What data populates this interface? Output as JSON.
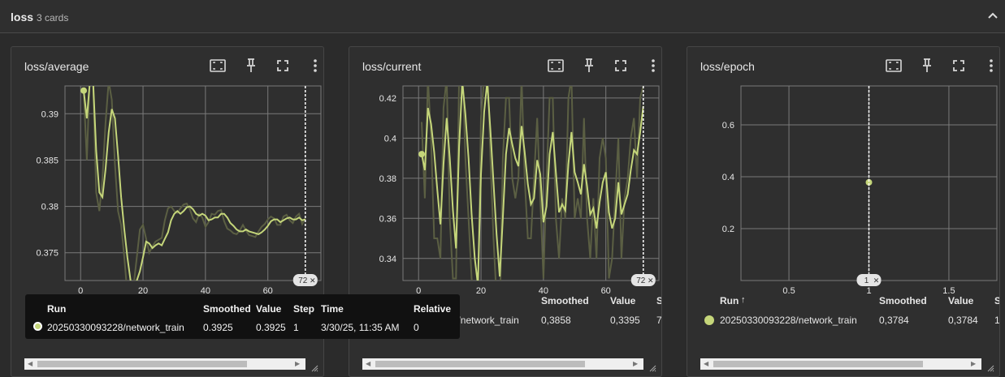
{
  "section": {
    "title": "loss",
    "count": "3 cards"
  },
  "icons": {
    "collapse": "chevron-up-icon",
    "fit": "fit-domain-icon",
    "pin": "pin-icon",
    "fullscreen": "fullscreen-icon",
    "more": "more-vert-icon"
  },
  "colors": {
    "smoothed": "#c5d67a",
    "raw": "#5b5f43",
    "grid": "#7a7a7a",
    "background": "#2f2f2f"
  },
  "cards": [
    {
      "title": "loss/average",
      "step_badge": "72",
      "table": {
        "headers": [
          "Run",
          "Smoothed",
          "Value",
          "S"
        ],
        "row": [
          "20250330093228/network_train",
          "0,3925",
          "0,3925",
          "1"
        ]
      }
    },
    {
      "title": "loss/current",
      "step_badge": "72",
      "table": {
        "headers": [
          "Run",
          "Smoothed",
          "Value",
          "S"
        ],
        "row": [
          "20250330093228/network_train",
          "0,3858",
          "0,3395",
          "7"
        ]
      }
    },
    {
      "title": "loss/epoch",
      "step_badge": "1",
      "table": {
        "headers": [
          "Run",
          "Smoothed",
          "Value",
          "S"
        ],
        "row": [
          "20250330093228/network_train",
          "0,3784",
          "0,3784",
          "1"
        ]
      }
    }
  ],
  "tooltip": {
    "headers": [
      "Run",
      "Smoothed",
      "Value",
      "Step",
      "Time",
      "Relative"
    ],
    "row": [
      "20250330093228/network_train",
      "0.3925",
      "0.3925",
      "1",
      "3/30/25, 11:35 AM",
      "0"
    ]
  },
  "chart_data": [
    {
      "type": "line",
      "title": "loss/average",
      "xlabel": "",
      "ylabel": "",
      "xlim": [
        -5,
        77
      ],
      "ylim": [
        0.372,
        0.393
      ],
      "xticks": [
        0,
        20,
        40,
        60
      ],
      "yticks": [
        0.375,
        0.38,
        0.385,
        0.39
      ],
      "cursor_x": 72,
      "series": [
        {
          "name": "20250330093228/network_train",
          "style": "smoothed",
          "x": [
            1,
            2,
            3,
            4,
            5,
            6,
            7,
            8,
            9,
            10,
            11,
            12,
            13,
            14,
            15,
            16,
            17,
            18,
            19,
            20,
            21,
            22,
            23,
            24,
            25,
            26,
            27,
            28,
            29,
            30,
            31,
            32,
            33,
            34,
            35,
            36,
            37,
            38,
            39,
            40,
            41,
            42,
            43,
            44,
            45,
            46,
            47,
            48,
            49,
            50,
            51,
            52,
            53,
            54,
            55,
            56,
            57,
            58,
            59,
            60,
            61,
            62,
            63,
            64,
            65,
            66,
            67,
            68,
            69,
            70,
            71,
            72
          ],
          "y": [
            0.3925,
            0.3895,
            0.3935,
            0.3935,
            0.386,
            0.3815,
            0.381,
            0.384,
            0.388,
            0.3905,
            0.3895,
            0.3855,
            0.381,
            0.3775,
            0.3745,
            0.372,
            0.3715,
            0.372,
            0.373,
            0.3745,
            0.3762,
            0.376,
            0.3755,
            0.3758,
            0.376,
            0.3758,
            0.3765,
            0.3772,
            0.3785,
            0.3792,
            0.3795,
            0.3792,
            0.3795,
            0.3799,
            0.38,
            0.3797,
            0.3792,
            0.379,
            0.3792,
            0.379,
            0.3785,
            0.3786,
            0.3788,
            0.3788,
            0.3792,
            0.3792,
            0.3788,
            0.3782,
            0.3779,
            0.3775,
            0.3773,
            0.3773,
            0.3775,
            0.3773,
            0.3772,
            0.3771,
            0.377,
            0.3772,
            0.3775,
            0.3779,
            0.3784,
            0.3786,
            0.3786,
            0.3783,
            0.3785,
            0.3787,
            0.3788,
            0.3786,
            0.3786,
            0.3788,
            0.3785,
            0.3786
          ]
        },
        {
          "name": "20250330093228/network_train",
          "style": "raw",
          "x": [
            1,
            2,
            3,
            4,
            5,
            6,
            7,
            8,
            9,
            10,
            11,
            12,
            13,
            14,
            15,
            16,
            17,
            18,
            19,
            20,
            21,
            22,
            23,
            24,
            25,
            26,
            27,
            28,
            29,
            30,
            31,
            32,
            33,
            34,
            35,
            36,
            37,
            38,
            39,
            40,
            41,
            42,
            43,
            44,
            45,
            46,
            47,
            48,
            49,
            50,
            51,
            52,
            53,
            54,
            55,
            56,
            57,
            58,
            59,
            60,
            61,
            62,
            63,
            64,
            65,
            66,
            67,
            68,
            69,
            70,
            71,
            72
          ],
          "y": [
            0.3925,
            0.385,
            0.3945,
            0.3935,
            0.3815,
            0.3795,
            0.383,
            0.389,
            0.3935,
            0.3915,
            0.3845,
            0.3795,
            0.378,
            0.3745,
            0.3705,
            0.3695,
            0.3715,
            0.3745,
            0.3775,
            0.378,
            0.3765,
            0.375,
            0.3757,
            0.3762,
            0.3764,
            0.3766,
            0.3785,
            0.3798,
            0.38,
            0.3795,
            0.3793,
            0.3798,
            0.3802,
            0.3803,
            0.3797,
            0.3787,
            0.3783,
            0.3792,
            0.3788,
            0.3778,
            0.3783,
            0.3792,
            0.3791,
            0.3795,
            0.3796,
            0.3784,
            0.3776,
            0.3774,
            0.3771,
            0.377,
            0.3774,
            0.378,
            0.3774,
            0.3769,
            0.3768,
            0.3767,
            0.3773,
            0.3778,
            0.3781,
            0.3786,
            0.3789,
            0.3787,
            0.378,
            0.378,
            0.3789,
            0.3791,
            0.3785,
            0.3782,
            0.3789,
            0.3792,
            0.3781,
            0.3787
          ]
        }
      ]
    },
    {
      "type": "line",
      "title": "loss/current",
      "xlabel": "",
      "ylabel": "",
      "xlim": [
        -5,
        77
      ],
      "ylim": [
        0.329,
        0.426
      ],
      "xticks": [
        0,
        20,
        40,
        60
      ],
      "yticks": [
        0.34,
        0.36,
        0.38,
        0.4,
        0.42
      ],
      "cursor_x": 72,
      "series": [
        {
          "name": "20250330093228/network_train",
          "style": "smoothed",
          "x": [
            1,
            2,
            3,
            4,
            5,
            6,
            7,
            8,
            9,
            10,
            11,
            12,
            13,
            14,
            15,
            16,
            17,
            18,
            19,
            20,
            21,
            22,
            23,
            24,
            25,
            26,
            27,
            28,
            29,
            30,
            31,
            32,
            33,
            34,
            35,
            36,
            37,
            38,
            39,
            40,
            41,
            42,
            43,
            44,
            45,
            46,
            47,
            48,
            49,
            50,
            51,
            52,
            53,
            54,
            55,
            56,
            57,
            58,
            59,
            60,
            61,
            62,
            63,
            64,
            65,
            66,
            67,
            68,
            69,
            70,
            71,
            72
          ],
          "y": [
            0.392,
            0.384,
            0.415,
            0.407,
            0.393,
            0.374,
            0.357,
            0.387,
            0.41,
            0.39,
            0.364,
            0.345,
            0.396,
            0.428,
            0.412,
            0.39,
            0.362,
            0.34,
            0.327,
            0.382,
            0.413,
            0.428,
            0.404,
            0.378,
            0.352,
            0.331,
            0.36,
            0.392,
            0.405,
            0.397,
            0.39,
            0.386,
            0.406,
            0.393,
            0.377,
            0.367,
            0.37,
            0.389,
            0.382,
            0.358,
            0.366,
            0.392,
            0.403,
            0.383,
            0.363,
            0.367,
            0.364,
            0.387,
            0.403,
            0.383,
            0.378,
            0.372,
            0.387,
            0.376,
            0.362,
            0.365,
            0.355,
            0.368,
            0.378,
            0.383,
            0.363,
            0.355,
            0.36,
            0.378,
            0.362,
            0.367,
            0.372,
            0.384,
            0.394,
            0.392,
            0.403,
            0.416
          ]
        },
        {
          "name": "20250330093228/network_train",
          "style": "raw",
          "x": [
            1,
            2,
            3,
            4,
            5,
            6,
            7,
            8,
            9,
            10,
            11,
            12,
            13,
            14,
            15,
            16,
            17,
            18,
            19,
            20,
            21,
            22,
            23,
            24,
            25,
            26,
            27,
            28,
            29,
            30,
            31,
            32,
            33,
            34,
            35,
            36,
            37,
            38,
            39,
            40,
            41,
            42,
            43,
            44,
            45,
            46,
            47,
            48,
            49,
            50,
            51,
            52,
            53,
            54,
            55,
            56,
            57,
            58,
            59,
            60,
            61,
            62,
            63,
            64,
            65,
            66,
            67,
            68,
            69,
            70,
            71,
            72
          ],
          "y": [
            0.408,
            0.37,
            0.43,
            0.4,
            0.35,
            0.35,
            0.34,
            0.415,
            0.43,
            0.36,
            0.33,
            0.33,
            0.43,
            0.44,
            0.39,
            0.36,
            0.33,
            0.32,
            0.32,
            0.41,
            0.43,
            0.44,
            0.39,
            0.35,
            0.32,
            0.31,
            0.39,
            0.42,
            0.42,
            0.38,
            0.37,
            0.38,
            0.43,
            0.38,
            0.35,
            0.35,
            0.38,
            0.41,
            0.37,
            0.33,
            0.38,
            0.42,
            0.42,
            0.36,
            0.34,
            0.37,
            0.36,
            0.42,
            0.43,
            0.36,
            0.37,
            0.36,
            0.41,
            0.36,
            0.34,
            0.37,
            0.34,
            0.39,
            0.4,
            0.39,
            0.33,
            0.34,
            0.37,
            0.4,
            0.34,
            0.37,
            0.38,
            0.4,
            0.41,
            0.38,
            0.42,
            0.426
          ]
        }
      ]
    },
    {
      "type": "scatter",
      "title": "loss/epoch",
      "xlabel": "",
      "ylabel": "",
      "xlim": [
        0.2,
        1.8
      ],
      "ylim": [
        0,
        0.75
      ],
      "xticks": [
        0.5,
        1,
        1.5
      ],
      "yticks": [
        0.2,
        0.4,
        0.6
      ],
      "cursor_x": 1,
      "series": [
        {
          "name": "20250330093228/network_train",
          "style": "smoothed",
          "x": [
            1
          ],
          "y": [
            0.3784
          ]
        }
      ]
    }
  ]
}
